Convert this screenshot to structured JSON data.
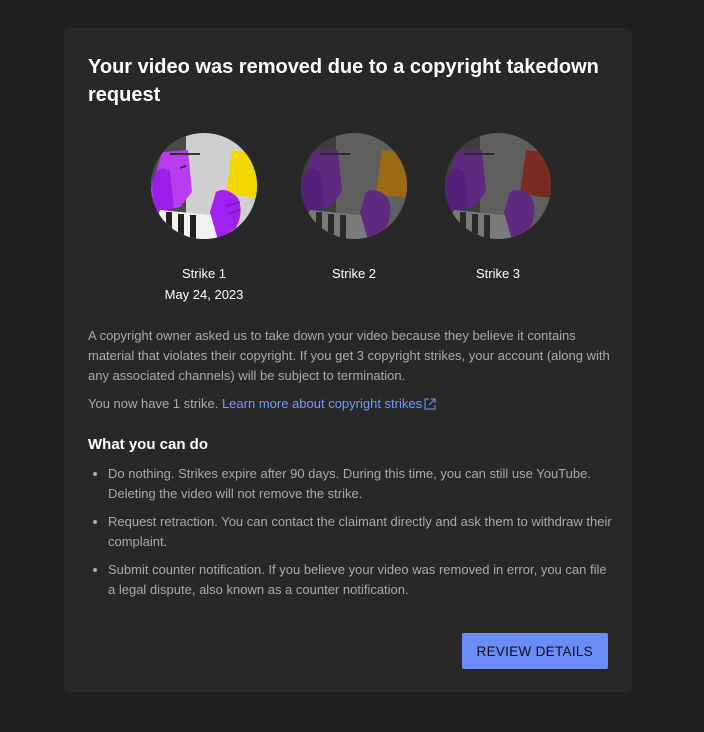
{
  "dialog": {
    "title": "Your video was removed due to a copyright takedown request",
    "strikes": [
      {
        "label": "Strike 1",
        "date": "May 24, 2023",
        "active": true,
        "card_color": "#f2d600"
      },
      {
        "label": "Strike 2",
        "date": "",
        "active": false,
        "card_color": "#c98a16"
      },
      {
        "label": "Strike 3",
        "date": "",
        "active": false,
        "card_color": "#c0392b"
      }
    ],
    "description": "A copyright owner asked us to take down your video because they believe it contains material that violates their copyright. If you get 3 copyright strikes, your account (along with any associated channels) will be subject to termination.",
    "strike_count_text": "You now have 1 strike.",
    "learn_more_link": "Learn more about copyright strikes",
    "section_title": "What you can do",
    "options": [
      "Do nothing. Strikes expire after 90 days. During this time, you can still use YouTube. Deleting the video will not remove the strike.",
      "Request retraction. You can contact the claimant directly and ask them to withdraw their complaint.",
      "Submit counter notification. If you believe your video was removed in error, you can file a legal dispute, also known as a counter notification."
    ],
    "review_button": "REVIEW DETAILS"
  },
  "colors": {
    "background": "#1f1f1f",
    "card": "#282828",
    "link": "#6f9bff",
    "button": "#6b8cf7",
    "purple": "#a020f0"
  },
  "icons": [
    "referee-strike-illustration",
    "external-link-icon"
  ]
}
